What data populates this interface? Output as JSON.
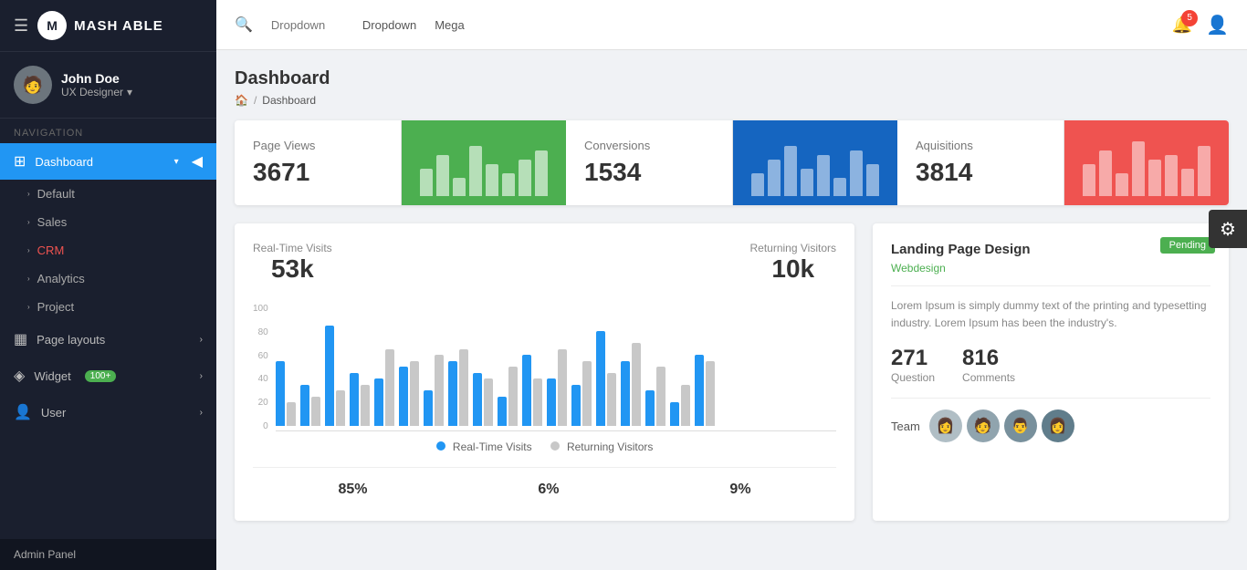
{
  "sidebar": {
    "logo_text": "MASH ABLE",
    "user_name": "John Doe",
    "user_role": "UX Designer",
    "nav_label": "Navigation",
    "items": [
      {
        "id": "dashboard",
        "label": "Dashboard",
        "icon": "⊞",
        "active": true,
        "has_arrow": true
      },
      {
        "id": "default",
        "label": "Default",
        "icon": "",
        "active": false,
        "has_arrow": false,
        "sub": true
      },
      {
        "id": "sales",
        "label": "Sales",
        "icon": "",
        "active": false,
        "has_arrow": false,
        "sub": true
      },
      {
        "id": "crm",
        "label": "CRM",
        "icon": "",
        "active": false,
        "has_arrow": false,
        "sub": true
      },
      {
        "id": "analytics",
        "label": "Analytics",
        "icon": "",
        "active": false,
        "has_arrow": false,
        "sub": true
      },
      {
        "id": "project",
        "label": "Project",
        "icon": "",
        "active": false,
        "has_arrow": false,
        "sub": true
      },
      {
        "id": "page_layouts",
        "label": "Page layouts",
        "icon": "▦",
        "active": false,
        "has_arrow": true
      },
      {
        "id": "widget",
        "label": "Widget",
        "icon": "◈",
        "active": false,
        "has_arrow": true,
        "badge": "100+"
      },
      {
        "id": "user",
        "label": "User",
        "icon": "👤",
        "active": false,
        "has_arrow": true
      }
    ],
    "footer_label": "Admin Panel"
  },
  "topbar": {
    "search_placeholder": "Dropdown",
    "nav_links": [
      "Dropdown",
      "Mega"
    ],
    "notif_count": "5"
  },
  "page": {
    "title": "Dashboard",
    "breadcrumb_home": "🏠",
    "breadcrumb_sep": "/",
    "breadcrumb_current": "Dashboard"
  },
  "stats": [
    {
      "label": "Page Views",
      "value": "3671",
      "chart_type": "green"
    },
    {
      "label": "Conversions",
      "value": "1534",
      "chart_type": "blue"
    },
    {
      "label": "Aquisitions",
      "value": "3814",
      "chart_type": "red"
    }
  ],
  "chart": {
    "stat1_label": "Real-Time Visits",
    "stat1_value": "53k",
    "stat2_label": "Returning Visitors",
    "stat2_value": "10k",
    "y_labels": [
      "100",
      "80",
      "60",
      "40",
      "20",
      "0"
    ],
    "bars": [
      {
        "blue": 55,
        "gray": 20
      },
      {
        "blue": 35,
        "gray": 25
      },
      {
        "blue": 85,
        "gray": 30
      },
      {
        "blue": 45,
        "gray": 35
      },
      {
        "blue": 40,
        "gray": 65
      },
      {
        "blue": 50,
        "gray": 55
      },
      {
        "blue": 30,
        "gray": 60
      },
      {
        "blue": 55,
        "gray": 65
      },
      {
        "blue": 45,
        "gray": 40
      },
      {
        "blue": 25,
        "gray": 50
      },
      {
        "blue": 60,
        "gray": 40
      },
      {
        "blue": 40,
        "gray": 65
      },
      {
        "blue": 35,
        "gray": 55
      },
      {
        "blue": 80,
        "gray": 45
      },
      {
        "blue": 55,
        "gray": 70
      },
      {
        "blue": 30,
        "gray": 50
      },
      {
        "blue": 20,
        "gray": 35
      },
      {
        "blue": 60,
        "gray": 55
      }
    ],
    "legend_blue": "Real-Time Visits",
    "legend_gray": "Returning Visitors",
    "percent1": "85%",
    "percent2": "6%",
    "percent3": "9%"
  },
  "right_panel": {
    "badge": "Pending",
    "title": "Landing Page Design",
    "tag": "Webdesign",
    "desc": "Lorem Ipsum is simply dummy text of the printing and typesetting industry. Lorem Ipsum has been the industry's.",
    "stat1_val": "271",
    "stat1_lbl": "Question",
    "stat2_val": "816",
    "stat2_lbl": "Comments",
    "team_label": "Team",
    "team_avatars": [
      "👩",
      "🧑",
      "👨",
      "👩"
    ]
  },
  "settings_cog": "⚙"
}
